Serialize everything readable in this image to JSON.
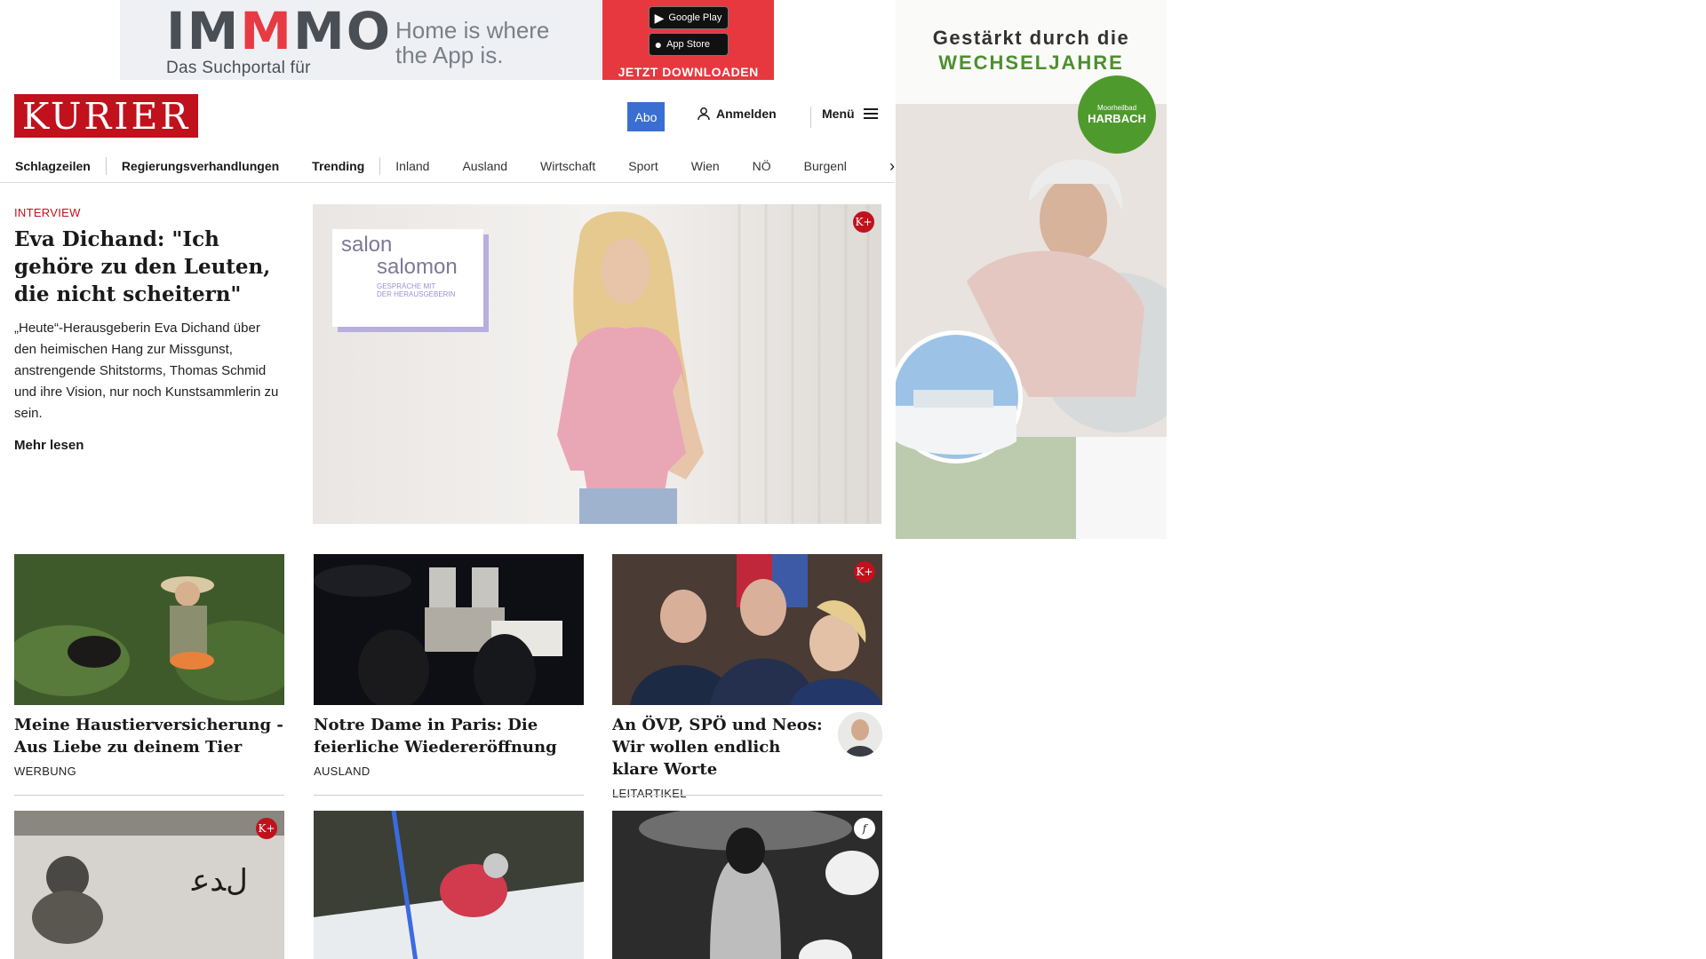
{
  "top_banner": {
    "brand": [
      "IM",
      "M",
      "MO"
    ],
    "subtitle": "Das Suchportal für Immobilien",
    "tagline_1": "Home is where",
    "tagline_2": "the App is.",
    "google_play": "Google Play",
    "app_store": "App Store",
    "cta": "JETZT DOWNLOADEN"
  },
  "header": {
    "logo": "KURIER",
    "abo": "Abo",
    "login": "Anmelden",
    "menu": "Menü"
  },
  "nav": {
    "items": [
      "Schlagzeilen",
      "Regierungsverhandlungen",
      "Trending",
      "Inland",
      "Ausland",
      "Wirtschaft",
      "Sport",
      "Wien",
      "NÖ",
      "Burgenl"
    ]
  },
  "hero": {
    "kicker": "INTERVIEW",
    "title": "Eva Dichand: \"Ich gehöre zu den Leuten, die nicht scheitern\"",
    "lead": "„Heute“-Herausgeberin Eva Dichand über den heimischen Hang zur Missgunst, anstrengende Shitstorms, Thomas Schmid und ihre Vision, nur noch Kunstsammlerin zu sein.",
    "more": "Mehr lesen",
    "badge_1": "salon",
    "badge_2": "salomon",
    "badge_3": "GESPRÄCHE MIT",
    "badge_4": "DER HERAUSGEBERIN",
    "plus_badge": "K+"
  },
  "cards": [
    {
      "title": "Meine Haustierversicherung - Aus Liebe zu deinem Tier",
      "category": "WERBUNG"
    },
    {
      "title": "Notre Dame in Paris: Die feierliche Wiedereröffnung",
      "category": "AUSLAND"
    },
    {
      "title": "An ÖVP, SPÖ und Neos: Wir wollen endlich klare Worte",
      "category": "LEITARTIKEL",
      "plus_badge": "K+"
    }
  ],
  "row2": {
    "plus_badge": "K+",
    "f_badge": "f"
  },
  "side_ad": {
    "line_1": "Gestärkt durch die",
    "line_2": "WECHSELJAHRE",
    "brand_small": "Moorheilbad",
    "brand": "HARBACH"
  },
  "colors": {
    "brand_red": "#c0111d",
    "abo_blue": "#3a6fd1",
    "immmo_red": "#e7383f",
    "ad_green": "#4d8f2e"
  }
}
